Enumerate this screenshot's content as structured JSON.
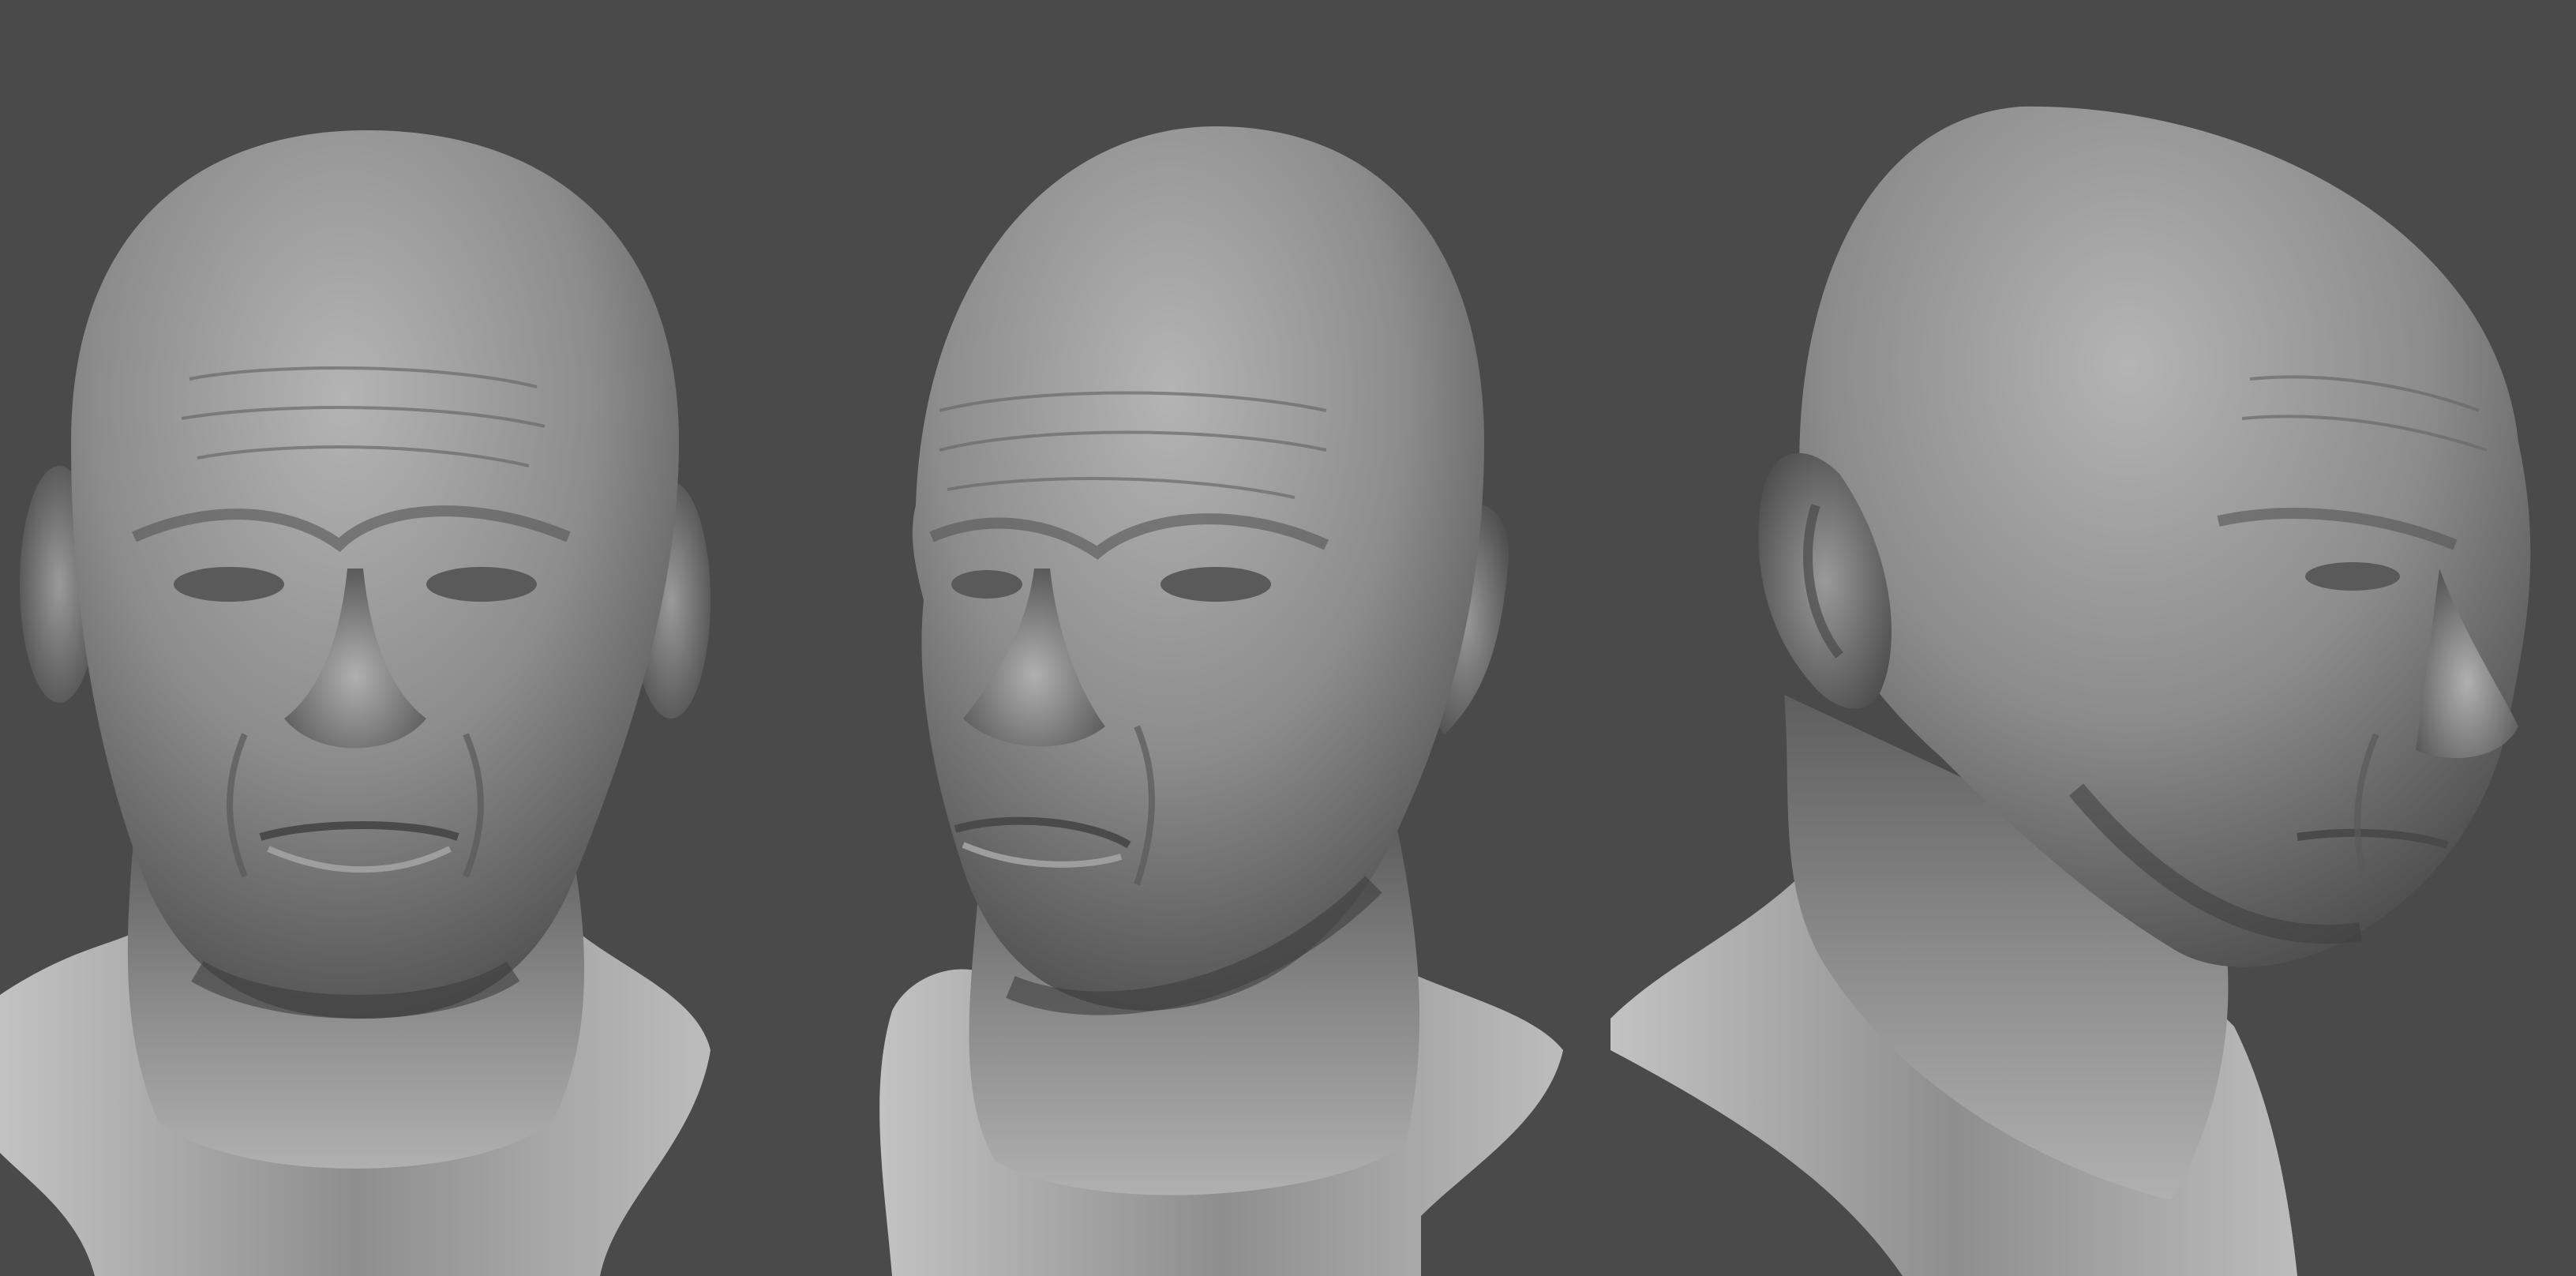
{
  "scene": {
    "background_color": "#4a4a4a",
    "clay_color": "#8a8a8a",
    "clay_highlight": "#bdbdbd",
    "clay_shadow": "#3a3a3a",
    "views": [
      {
        "name": "front",
        "label": ""
      },
      {
        "name": "three-quarter-left",
        "label": ""
      },
      {
        "name": "right-profile-three-quarter",
        "label": ""
      }
    ]
  }
}
